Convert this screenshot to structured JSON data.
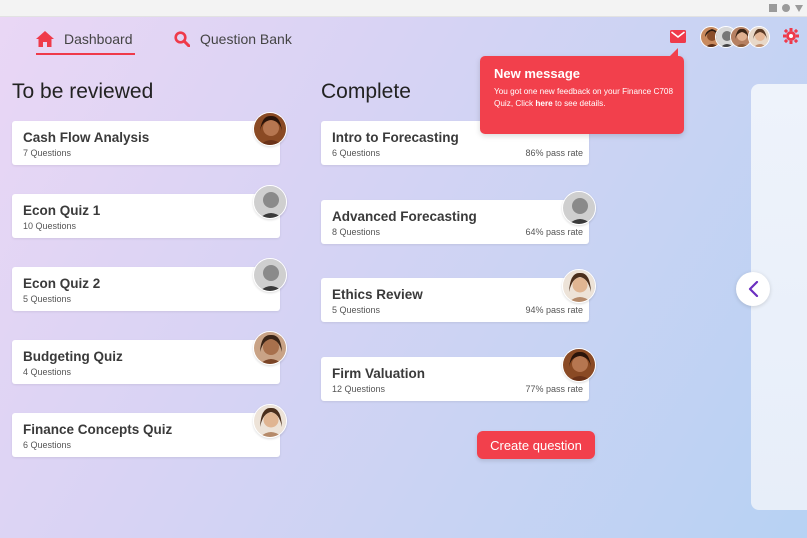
{
  "nav": {
    "dashboard_label": "Dashboard",
    "question_bank_label": "Question Bank",
    "accent_color": "#ef3a4a"
  },
  "header_icons": [
    "home-icon",
    "search-icon",
    "mail-icon",
    "gear-icon"
  ],
  "columns": {
    "review_heading": "To be reviewed",
    "complete_heading": "Complete"
  },
  "review_items": [
    {
      "title": "Cash Flow Analysis",
      "questions": "7 Questions"
    },
    {
      "title": "Econ Quiz 1",
      "questions": "10 Questions"
    },
    {
      "title": "Econ Quiz 2",
      "questions": "5 Questions"
    },
    {
      "title": "Budgeting Quiz",
      "questions": "4 Questions"
    },
    {
      "title": "Finance Concepts Quiz",
      "questions": "6 Questions"
    }
  ],
  "complete_items": [
    {
      "title": "Intro to Forecasting",
      "questions": "6 Questions",
      "rate": "86% pass rate"
    },
    {
      "title": "Advanced Forecasting",
      "questions": "8 Questions",
      "rate": "64% pass rate"
    },
    {
      "title": "Ethics Review",
      "questions": "5 Questions",
      "rate": "94% pass rate"
    },
    {
      "title": "Firm Valuation",
      "questions": "12 Questions",
      "rate": "77% pass rate"
    }
  ],
  "toast": {
    "title": "New message",
    "body_before": "You got one new feedback on your Finance C708 Quiz, Click ",
    "link": "here",
    "body_after": " to see details."
  },
  "create_button_label": "Create question"
}
